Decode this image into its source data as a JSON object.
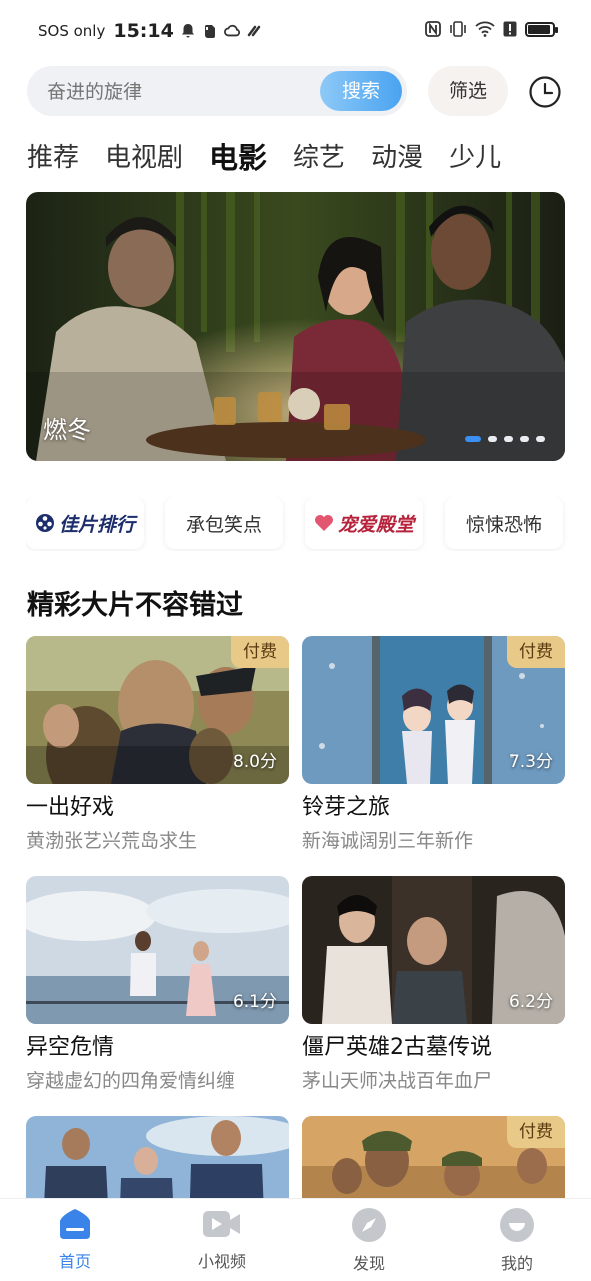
{
  "status_bar": {
    "carrier": "SOS only",
    "time": "15:14",
    "icons": [
      "bell-icon",
      "evernote-icon",
      "cloud-icon",
      "link-icon",
      "nfc-icon",
      "vibrate-icon",
      "wifi-icon",
      "alert-icon",
      "battery-icon"
    ]
  },
  "search": {
    "placeholder": "奋进的旋律",
    "button_label": "搜索",
    "filter_label": "筛选"
  },
  "tabs": [
    {
      "label": "推荐",
      "active": false
    },
    {
      "label": "电视剧",
      "active": false
    },
    {
      "label": "电影",
      "active": true
    },
    {
      "label": "综艺",
      "active": false
    },
    {
      "label": "动漫",
      "active": false
    },
    {
      "label": "少儿",
      "active": false
    }
  ],
  "banner": {
    "title": "燃冬",
    "page_count": 5,
    "active_index": 0
  },
  "shortcuts": [
    {
      "label": "佳片排行"
    },
    {
      "label": "承包笑点"
    },
    {
      "label": "宠爱殿堂"
    },
    {
      "label": "惊悚恐怖"
    }
  ],
  "section": {
    "title": "精彩大片不容错过"
  },
  "movies": [
    {
      "title": "一出好戏",
      "subtitle": "黄渤张艺兴荒岛求生",
      "badge": "付费",
      "score": "8.0分"
    },
    {
      "title": "铃芽之旅",
      "subtitle": "新海诚阔别三年新作",
      "badge": "付费",
      "score": "7.3分"
    },
    {
      "title": "异空危情",
      "subtitle": "穿越虚幻的四角爱情纠缠",
      "badge": "",
      "score": "6.1分"
    },
    {
      "title": "僵尸英雄2古墓传说",
      "subtitle": "茅山天师决战百年血尸",
      "badge": "",
      "score": "6.2分"
    },
    {
      "title": "",
      "subtitle": "",
      "badge": "",
      "score": ""
    },
    {
      "title": "",
      "subtitle": "",
      "badge": "付费",
      "score": ""
    }
  ],
  "bottom_nav": [
    {
      "label": "首页",
      "icon": "home-icon",
      "active": true
    },
    {
      "label": "小视频",
      "icon": "video-icon",
      "active": false
    },
    {
      "label": "发现",
      "icon": "compass-icon",
      "active": false
    },
    {
      "label": "我的",
      "icon": "profile-icon",
      "active": false
    }
  ],
  "colors": {
    "accent": "#3a83e8",
    "pay_badge": "#e9c988"
  }
}
